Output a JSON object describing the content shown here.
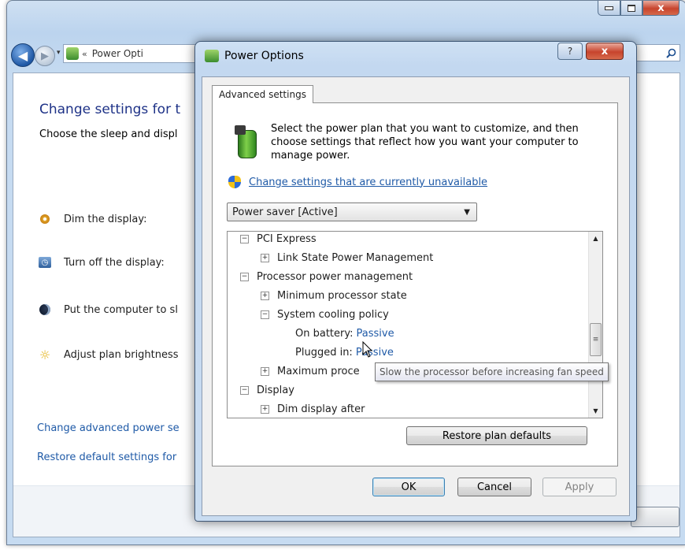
{
  "main_window": {
    "caption": {
      "close_label": "x"
    },
    "nav": {
      "back_glyph": "◀",
      "forward_glyph": "▶",
      "history_glyph": "▾",
      "address_sep": "«",
      "address_text": "Power Opti"
    },
    "page_title": "Change settings for t",
    "page_subtitle": "Choose the sleep and displ",
    "settings": [
      {
        "label": "Dim the display:",
        "icon": "dim-icon"
      },
      {
        "label": "Turn off the display:",
        "icon": "clock-icon"
      },
      {
        "label": "Put the computer to sl",
        "icon": "moon-icon"
      },
      {
        "label": "Adjust plan brightness",
        "icon": "sun-icon"
      }
    ],
    "links": {
      "change_advanced": "Change advanced power se",
      "restore_default": "Restore default settings for"
    }
  },
  "dialog": {
    "title": "Power Options",
    "help_label": "?",
    "close_label": "x",
    "tab_label": "Advanced settings",
    "description": "Select the power plan that you want to customize, and then choose settings that reflect how you want your computer to manage power.",
    "uac_link": "Change settings that are currently unavailable",
    "plan_select": {
      "value": "Power saver [Active]"
    },
    "tree": {
      "rows": [
        {
          "toggle": "−",
          "label": "PCI Express"
        },
        {
          "toggle": "+",
          "label": "Link State Power Management"
        },
        {
          "toggle": "−",
          "label": "Processor power management"
        },
        {
          "toggle": "+",
          "label": "Minimum processor state"
        },
        {
          "toggle": "−",
          "label": "System cooling policy"
        },
        {
          "label": "On battery:",
          "value": "Passive"
        },
        {
          "label": "Plugged in:",
          "value": "Passive"
        },
        {
          "toggle": "+",
          "label": "Maximum proce"
        },
        {
          "toggle": "−",
          "label": "Display"
        },
        {
          "toggle": "+",
          "label": "Dim display after"
        }
      ]
    },
    "tooltip": "Slow the processor before increasing fan speed",
    "restore_button": "Restore plan defaults",
    "ok_button": "OK",
    "cancel_button": "Cancel",
    "apply_button": "Apply"
  }
}
